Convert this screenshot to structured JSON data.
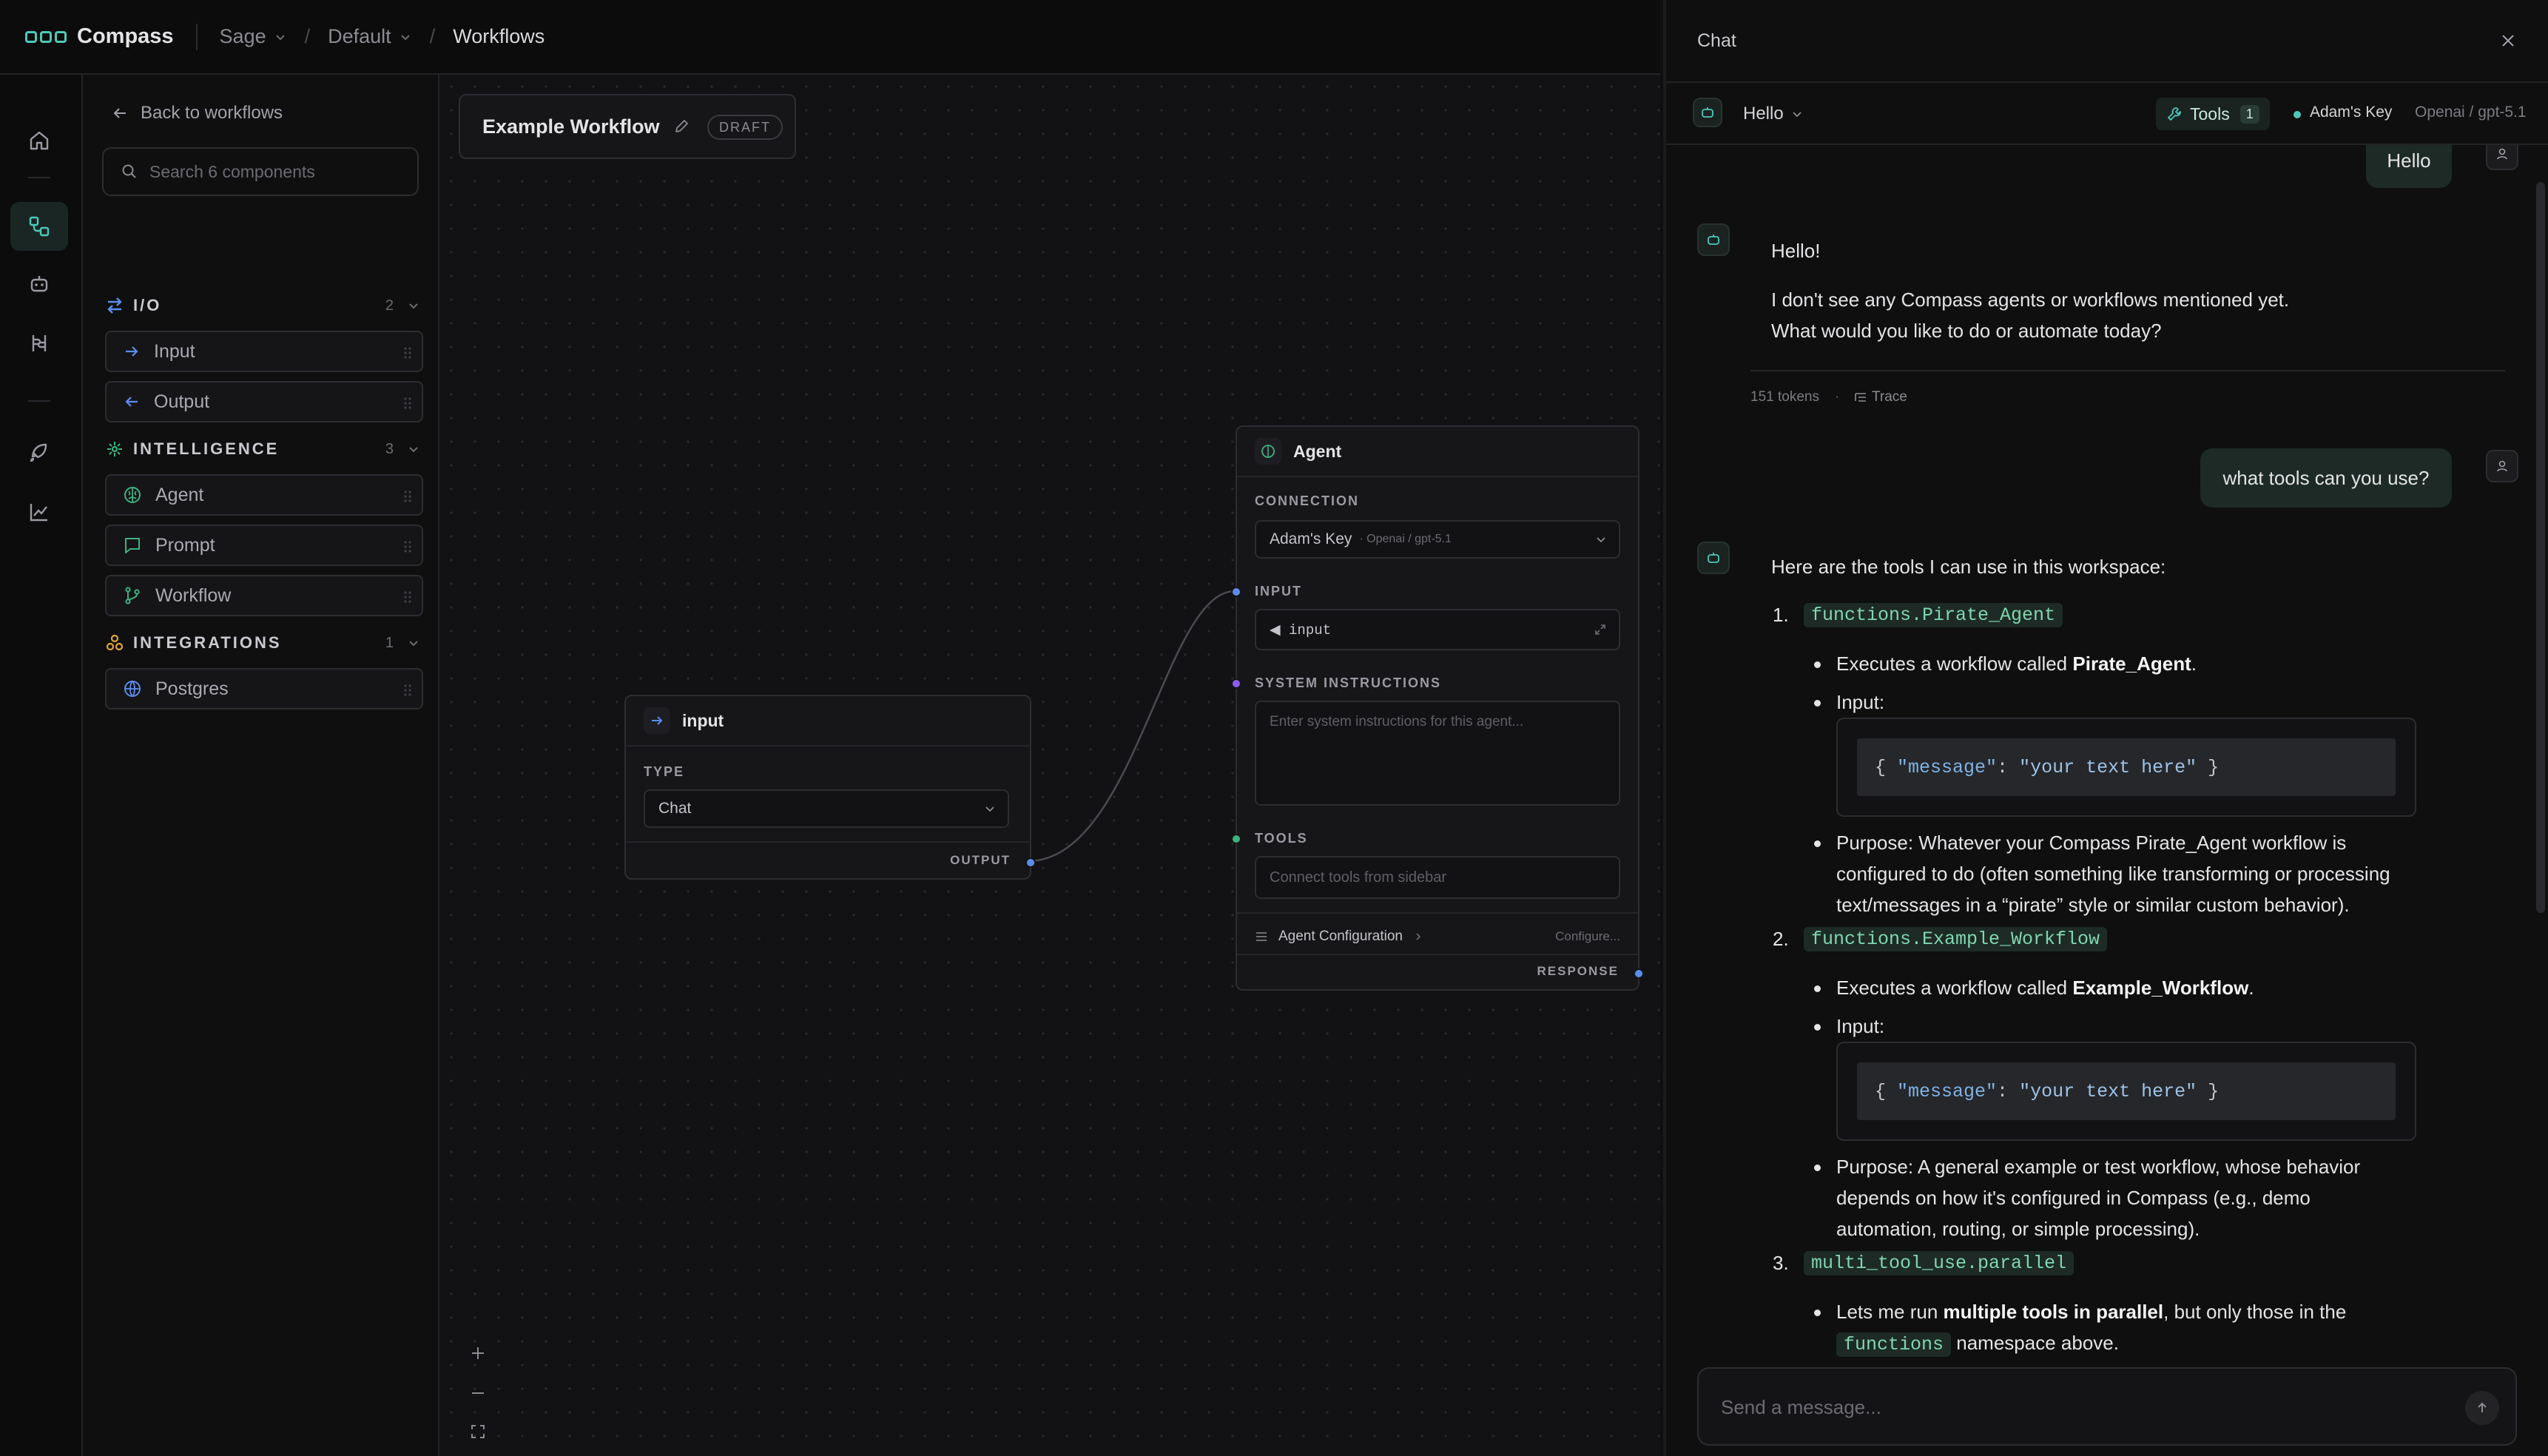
{
  "app": {
    "brand": "Compass"
  },
  "breadcrumb": {
    "org": "Sage",
    "env": "Default",
    "page": "Workflows"
  },
  "sidebar": {
    "back_label": "Back to workflows",
    "search_placeholder": "Search 6 components",
    "sections": [
      {
        "title": "I/O",
        "count": "2",
        "items": [
          "Input",
          "Output"
        ]
      },
      {
        "title": "INTELLIGENCE",
        "count": "3",
        "items": [
          "Agent",
          "Prompt",
          "Workflow"
        ]
      },
      {
        "title": "INTEGRATIONS",
        "count": "1",
        "items": [
          "Postgres"
        ]
      }
    ]
  },
  "canvas": {
    "workflow_name": "Example Workflow",
    "status_badge": "DRAFT",
    "input_node": {
      "title": "input",
      "type_label": "TYPE",
      "type_value": "Chat",
      "output_label": "OUTPUT"
    },
    "agent_node": {
      "title": "Agent",
      "connection_label": "CONNECTION",
      "connection_value": "Adam's Key",
      "connection_model": "· Openai / gpt-5.1",
      "input_label": "INPUT",
      "input_value": "◀ input",
      "system_label": "SYSTEM INSTRUCTIONS",
      "system_placeholder": "Enter system instructions for this agent...",
      "tools_label": "TOOLS",
      "tools_placeholder": "Connect tools from sidebar",
      "config_label": "Agent Configuration",
      "config_action": "Configure...",
      "response_label": "RESPONSE"
    }
  },
  "chat": {
    "title": "Chat",
    "session": "Hello",
    "tools_label": "Tools",
    "tools_count": "1",
    "key_name": "Adam's Key",
    "model": "Openai / gpt-5.1",
    "composer_placeholder": "Send a message...",
    "messages": {
      "user1": "Hello",
      "assistant1_greeting": "Hello!",
      "assistant1_line1": "I don't see any Compass agents or workflows mentioned yet.",
      "assistant1_line2": "What would you like to do or automate today?",
      "tokens": "151 tokens",
      "trace": "Trace",
      "user2": "what tools can you use?",
      "intro": "Here are the tools I can use in this workspace:",
      "tool1_num": "1.",
      "tool1_name": "functions.Pirate_Agent",
      "tool1_exec_a": "Executes a workflow called ",
      "tool1_exec_b": "Pirate_Agent",
      "tool1_exec_c": ".",
      "tool1_input": "Input:",
      "tool1_purpose_1": "Purpose: Whatever your Compass Pirate_Agent workflow is",
      "tool1_purpose_2": "configured to do (often something like transforming or processing",
      "tool1_purpose_3": "text/messages in a “pirate” style or similar custom behavior).",
      "tool2_num": "2.",
      "tool2_name": "functions.Example_Workflow",
      "tool2_exec_a": "Executes a workflow called ",
      "tool2_exec_b": "Example_Workflow",
      "tool2_exec_c": ".",
      "tool2_input": "Input:",
      "tool2_purpose_1": "Purpose: A general example or test workflow, whose behavior",
      "tool2_purpose_2": "depends on how it's configured in Compass (e.g., demo",
      "tool2_purpose_3": "automation, routing, or simple processing).",
      "tool3_num": "3.",
      "tool3_name": "multi_tool_use.parallel",
      "tool3_desc_a": "Lets me run ",
      "tool3_desc_b": "multiple tools in parallel",
      "tool3_desc_c": ", but only those in the",
      "tool3_ns": "functions",
      "tool3_desc_d": "namespace above.",
      "code_open": "{ ",
      "code_key": "\"message\"",
      "code_colon": ": ",
      "code_val": "\"your text here\"",
      "code_close": " }"
    }
  },
  "colors": {
    "accent": "#4cc9b8",
    "io": "#5b8def",
    "intelligence": "#3fb27f",
    "integrations": "#e0a53a",
    "system_port": "#8b5cf6"
  }
}
